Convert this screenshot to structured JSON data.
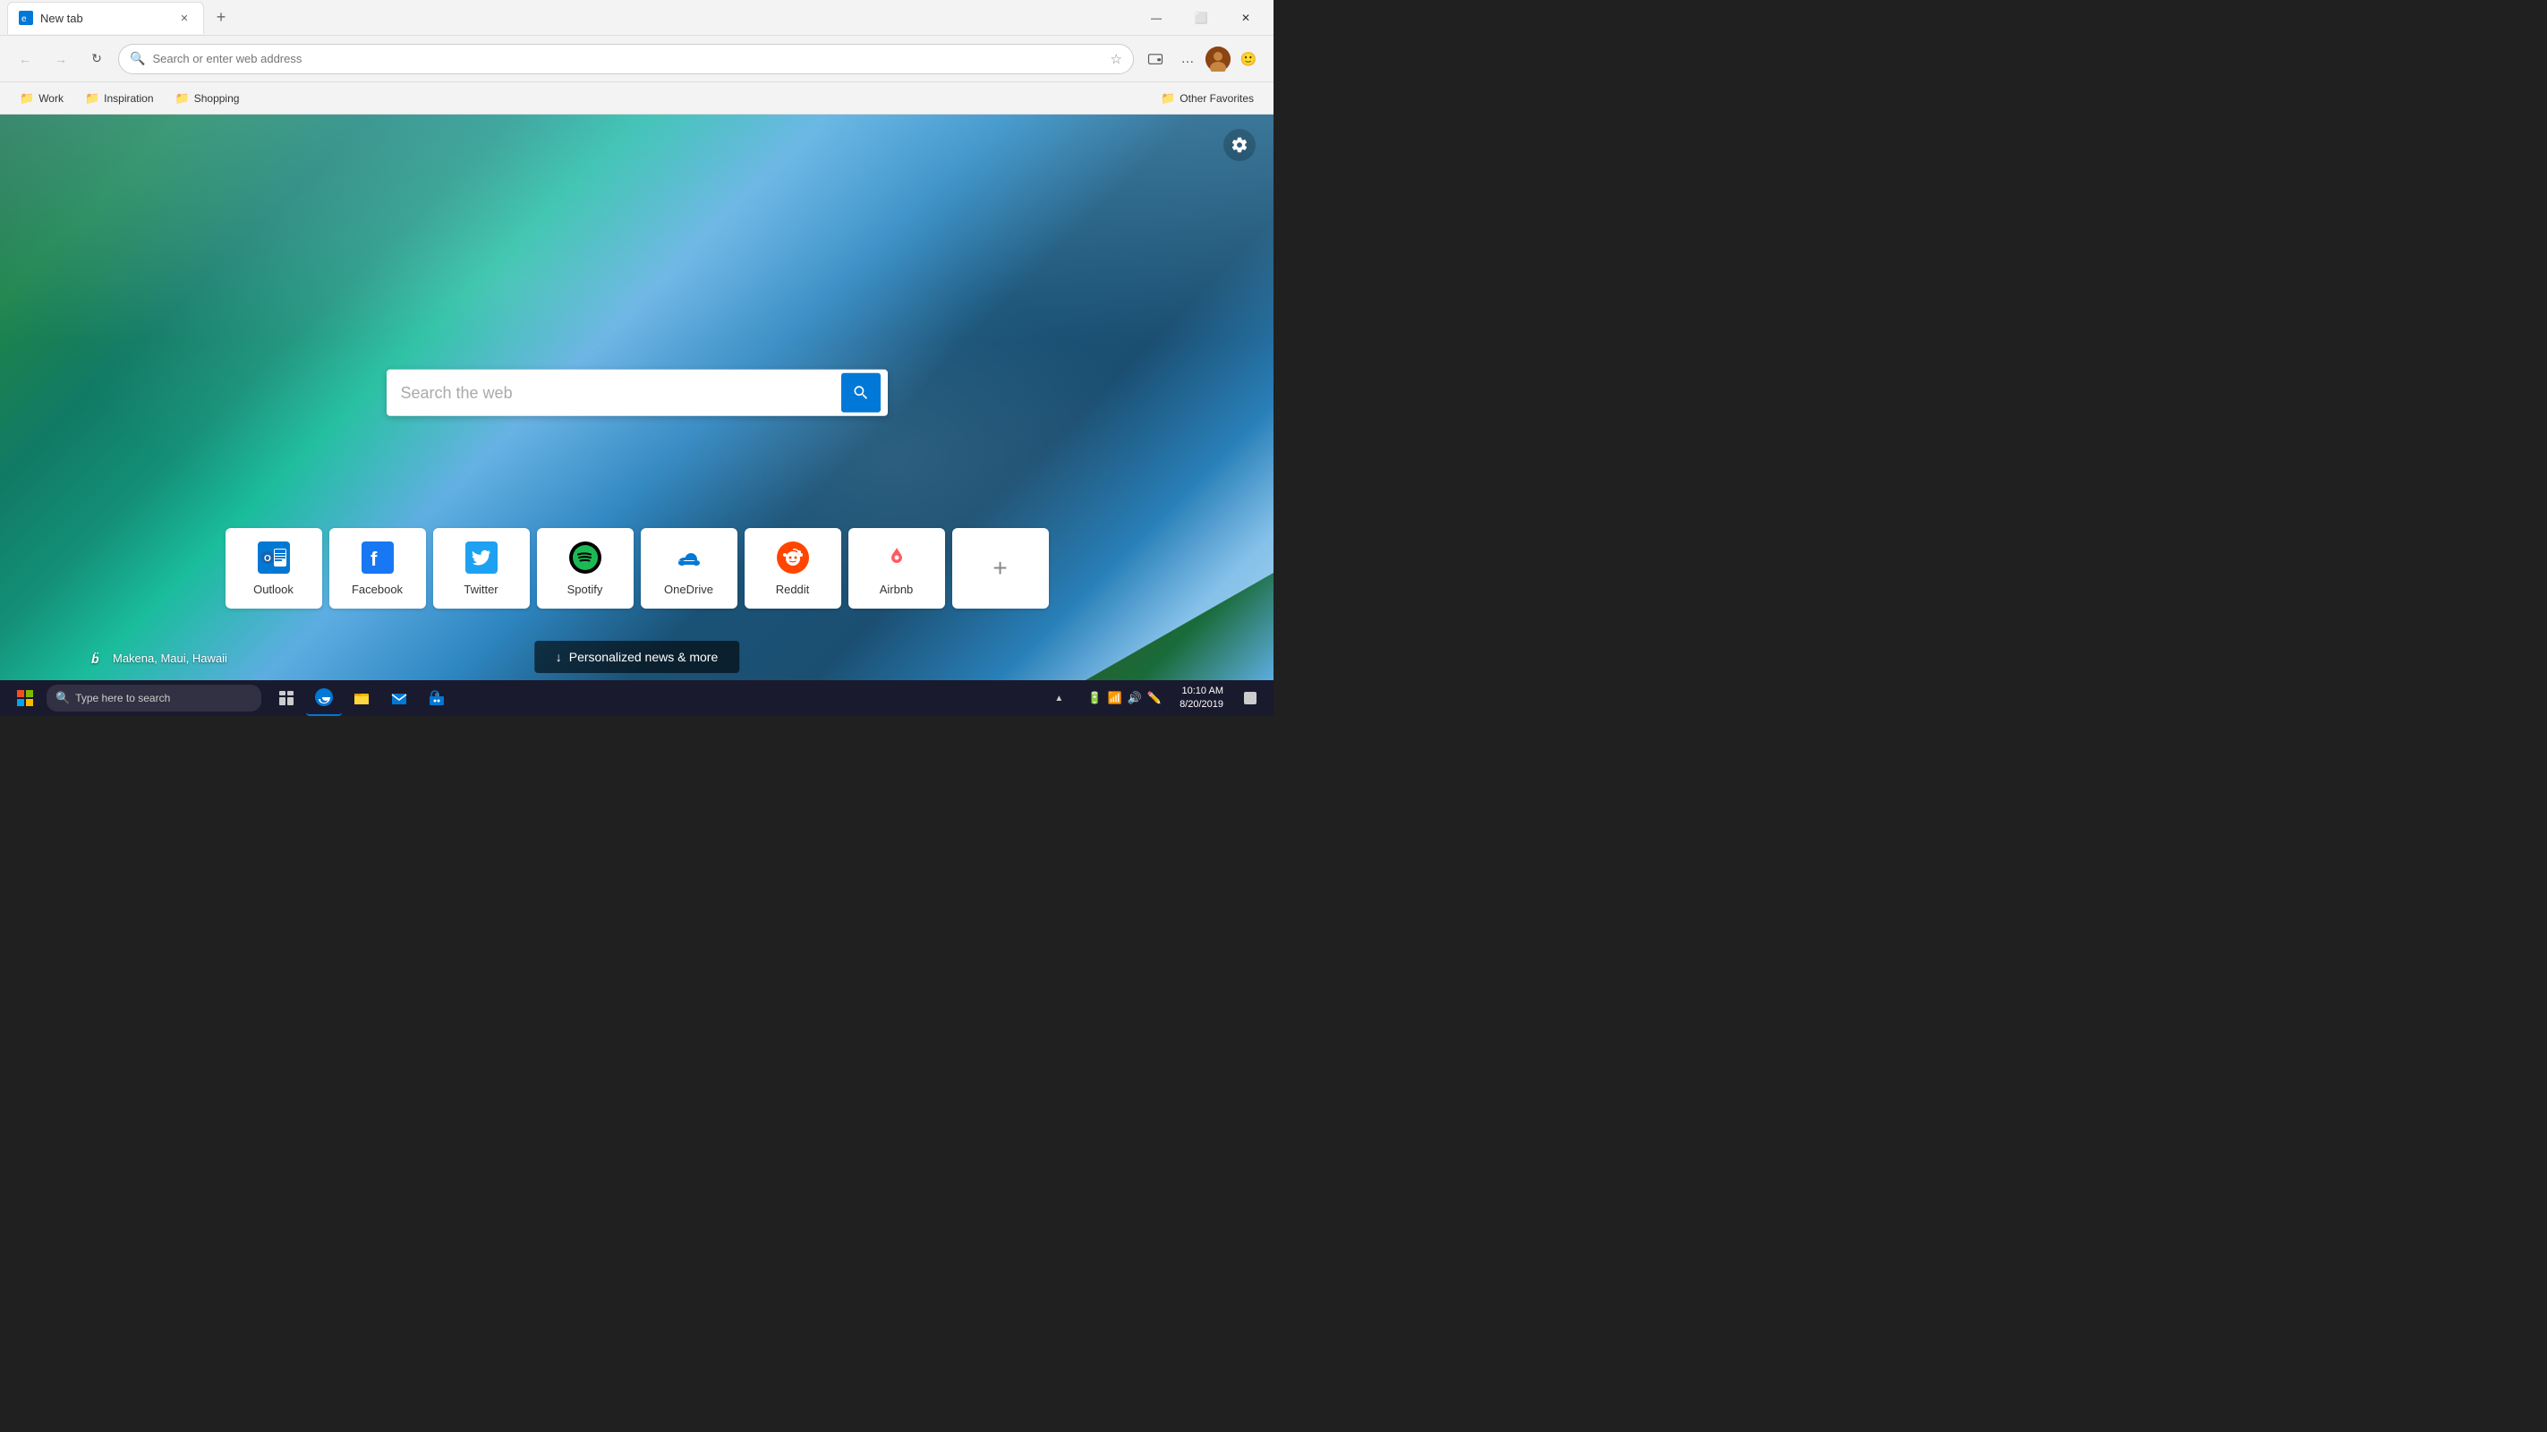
{
  "titlebar": {
    "tab_label": "New tab",
    "new_tab_label": "+",
    "min_label": "—",
    "max_label": "⬜",
    "close_label": "✕"
  },
  "addressbar": {
    "placeholder": "Search or enter web address",
    "back_label": "←",
    "forward_label": "→",
    "refresh_label": "↻",
    "more_label": "…"
  },
  "bookmarks": {
    "work_label": "Work",
    "inspiration_label": "Inspiration",
    "shopping_label": "Shopping",
    "other_label": "Other Favorites"
  },
  "search": {
    "placeholder": "Search the web",
    "search_label": "🔍"
  },
  "quick_links": [
    {
      "id": "outlook",
      "label": "Outlook"
    },
    {
      "id": "facebook",
      "label": "Facebook"
    },
    {
      "id": "twitter",
      "label": "Twitter"
    },
    {
      "id": "spotify",
      "label": "Spotify"
    },
    {
      "id": "onedrive",
      "label": "OneDrive"
    },
    {
      "id": "reddit",
      "label": "Reddit"
    },
    {
      "id": "airbnb",
      "label": "Airbnb"
    },
    {
      "id": "add",
      "label": ""
    }
  ],
  "bing_credit": {
    "logo": "b̈",
    "location": "Makena, Maui, Hawaii"
  },
  "news_btn": {
    "label": "Personalized news & more"
  },
  "taskbar": {
    "search_placeholder": "Type here to search",
    "time": "10:10 AM",
    "date": "8/20/2019"
  }
}
